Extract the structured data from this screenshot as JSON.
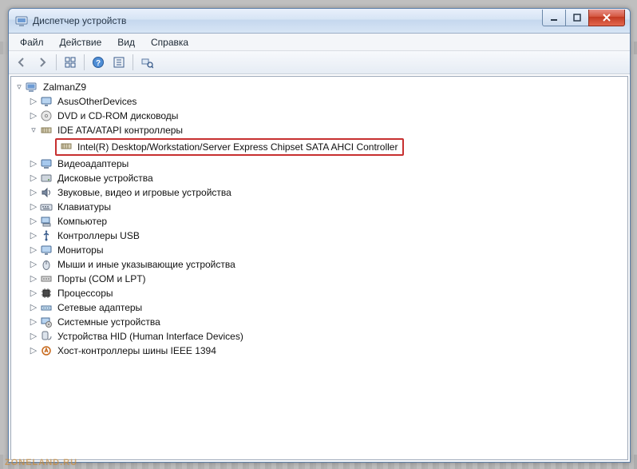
{
  "window": {
    "title": "Диспетчер устройств"
  },
  "menu": {
    "file": "Файл",
    "action": "Действие",
    "view": "Вид",
    "help": "Справка"
  },
  "tree": {
    "root": "ZalmanZ9",
    "items": [
      {
        "label": "AsusOtherDevices",
        "icon": "monitor"
      },
      {
        "label": "DVD и CD-ROM дисководы",
        "icon": "disc"
      },
      {
        "label": "IDE ATA/ATAPI контроллеры",
        "icon": "controller",
        "expanded": true,
        "children": [
          {
            "label": "Intel(R) Desktop/Workstation/Server Express Chipset SATA AHCI Controller",
            "icon": "controller",
            "highlight": true
          }
        ]
      },
      {
        "label": "Видеоадаптеры",
        "icon": "display"
      },
      {
        "label": "Дисковые устройства",
        "icon": "drive"
      },
      {
        "label": "Звуковые, видео и игровые устройства",
        "icon": "sound"
      },
      {
        "label": "Клавиатуры",
        "icon": "keyboard"
      },
      {
        "label": "Компьютер",
        "icon": "computer"
      },
      {
        "label": "Контроллеры USB",
        "icon": "usb"
      },
      {
        "label": "Мониторы",
        "icon": "monitor"
      },
      {
        "label": "Мыши и иные указывающие устройства",
        "icon": "mouse"
      },
      {
        "label": "Порты (COM и LPT)",
        "icon": "port"
      },
      {
        "label": "Процессоры",
        "icon": "cpu"
      },
      {
        "label": "Сетевые адаптеры",
        "icon": "network"
      },
      {
        "label": "Системные устройства",
        "icon": "system"
      },
      {
        "label": "Устройства HID (Human Interface Devices)",
        "icon": "hid"
      },
      {
        "label": "Хост-контроллеры шины IEEE 1394",
        "icon": "firewire"
      }
    ]
  },
  "watermark": "ZONELAND.RU"
}
